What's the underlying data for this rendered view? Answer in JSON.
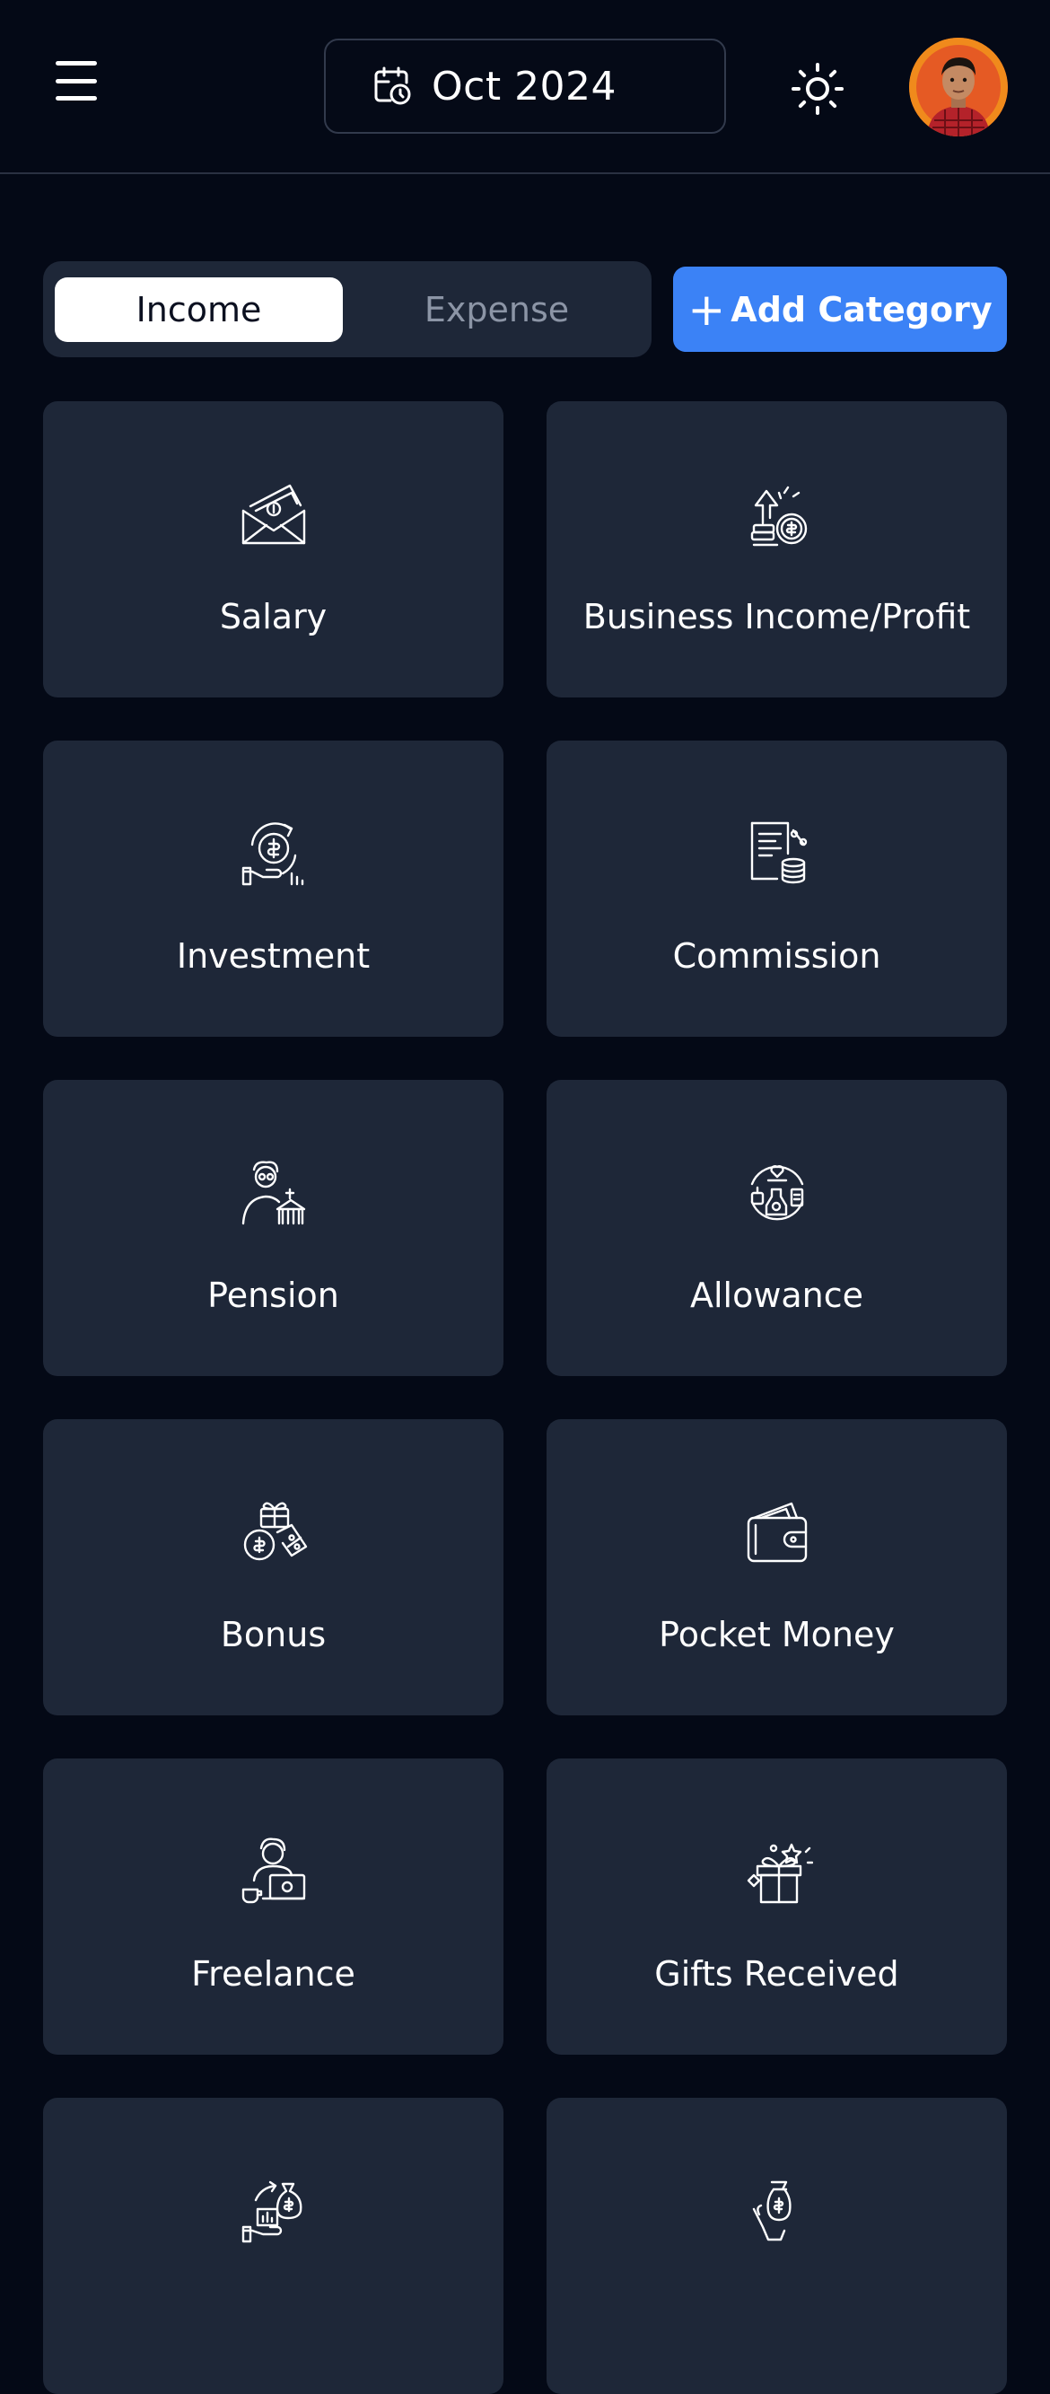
{
  "header": {
    "date_label": "Oct 2024"
  },
  "tabs": {
    "income_label": "Income",
    "expense_label": "Expense",
    "active": "Income"
  },
  "actions": {
    "add_category_label": "Add Category"
  },
  "categories": [
    {
      "label": "Salary",
      "icon": "salary-envelope-icon"
    },
    {
      "label": "Business Income/Profit",
      "icon": "business-growth-icon"
    },
    {
      "label": "Investment",
      "icon": "investment-hand-coin-icon"
    },
    {
      "label": "Commission",
      "icon": "commission-receipt-icon"
    },
    {
      "label": "Pension",
      "icon": "pension-elder-icon"
    },
    {
      "label": "Allowance",
      "icon": "allowance-circle-icon"
    },
    {
      "label": "Bonus",
      "icon": "bonus-gift-coin-icon"
    },
    {
      "label": "Pocket Money",
      "icon": "wallet-icon"
    },
    {
      "label": "Freelance",
      "icon": "freelance-laptop-icon"
    },
    {
      "label": "Gifts Received",
      "icon": "gift-box-icon"
    },
    {
      "label": "",
      "icon": "money-bag-chart-icon"
    },
    {
      "label": "",
      "icon": "hand-money-icon"
    }
  ],
  "colors": {
    "background": "#040916",
    "card": "#1e2738",
    "accent": "#3b82f6"
  }
}
